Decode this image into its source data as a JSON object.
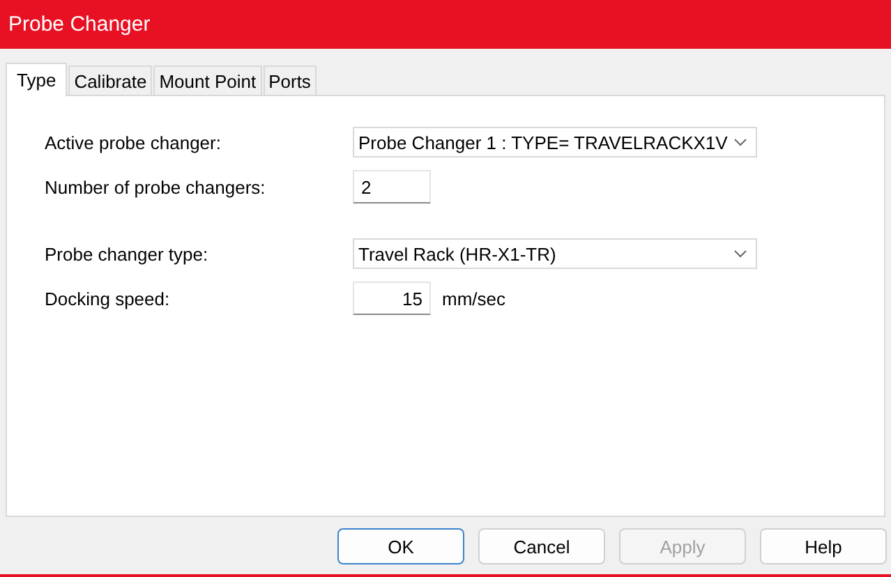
{
  "window": {
    "title": "Probe Changer"
  },
  "tabs": [
    {
      "label": "Type",
      "selected": true
    },
    {
      "label": "Calibrate",
      "selected": false
    },
    {
      "label": "Mount Point",
      "selected": false
    },
    {
      "label": "Ports",
      "selected": false
    }
  ],
  "fields": [
    {
      "label": "Active probe changer:",
      "kind": "dropdown",
      "value": "Probe Changer 1 : TYPE= TRAVELRACKX1V"
    },
    {
      "label": "Number of probe changers:",
      "kind": "number",
      "value": "2"
    },
    {
      "label": "Probe changer type:",
      "kind": "dropdown",
      "value": "Travel Rack (HR-X1-TR)"
    },
    {
      "label": "Docking speed:",
      "kind": "number",
      "value": "15",
      "unit": "mm/sec"
    }
  ],
  "buttons": [
    {
      "label": "OK",
      "default": true,
      "disabled": false
    },
    {
      "label": "Cancel",
      "default": false,
      "disabled": false
    },
    {
      "label": "Apply",
      "default": false,
      "disabled": true
    },
    {
      "label": "Help",
      "default": false,
      "disabled": false
    }
  ]
}
